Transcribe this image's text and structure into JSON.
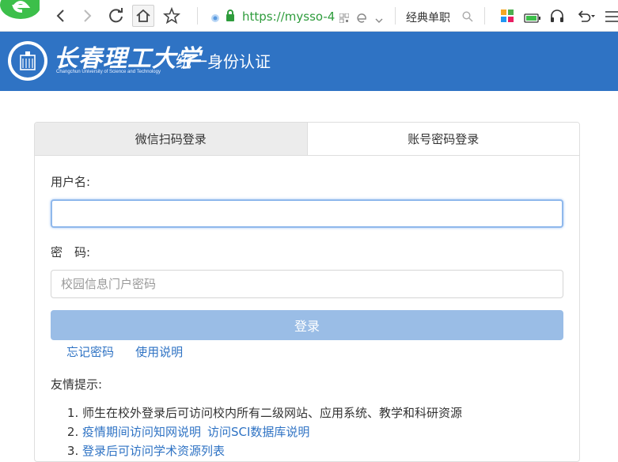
{
  "browser": {
    "url": "https://mysso-4",
    "search_text": "经典单职"
  },
  "header": {
    "university_name": "长春理工大学",
    "university_english": "Changchun University of Science and Technology",
    "system_title": "统一身份认证"
  },
  "login": {
    "tabs": [
      {
        "label": "微信扫码登录",
        "active": false
      },
      {
        "label": "账号密码登录",
        "active": true
      }
    ],
    "username_label": "用户名:",
    "username_value": "",
    "password_label": "密　码:",
    "password_placeholder": "校园信息门户密码",
    "login_button": "登录",
    "forgot_password": "忘记密码",
    "instructions": "使用说明",
    "tips_title": "友情提示:",
    "tips": [
      {
        "text": "师生在校外登录后可访问校内所有二级网站、应用系统、教学和科研资源"
      },
      {
        "links": [
          "疫情期间访问知网说明",
          "访问SCI数据库说明"
        ]
      },
      {
        "links": [
          "登录后可访问学术资源列表"
        ]
      }
    ]
  },
  "colors": {
    "header_bg": "#2f73c4",
    "link": "#2f73c4",
    "login_button_bg": "#9abde6",
    "url_green": "#2e9c3c"
  }
}
